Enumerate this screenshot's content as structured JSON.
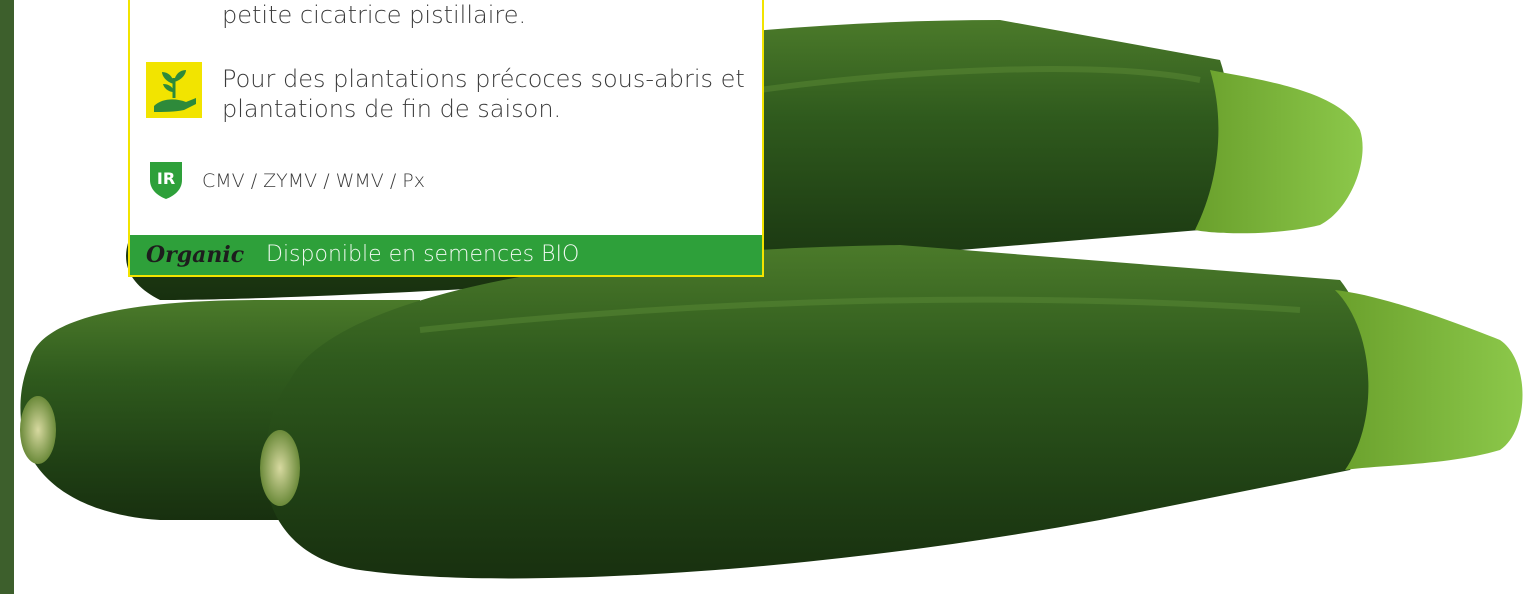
{
  "info_card": {
    "description_line": "petite cicatrice pistillaire.",
    "planting_line_1": "Pour des plantations précoces sous-abris et",
    "planting_line_2": "plantations de fin de saison.",
    "resistance_badge": "IR",
    "resistances": "CMV / ZYMV / WMV / Px",
    "organic_logo": "Organic",
    "organic_note": "Disponible en semences BIO"
  },
  "icons": {
    "planting": "hand-with-sprout-icon",
    "resistance": "shield-icon"
  },
  "colors": {
    "card_border": "#f2e400",
    "organic_bar": "#2ea03a",
    "icon_bg": "#f2e400",
    "shield": "#2ea03a"
  }
}
